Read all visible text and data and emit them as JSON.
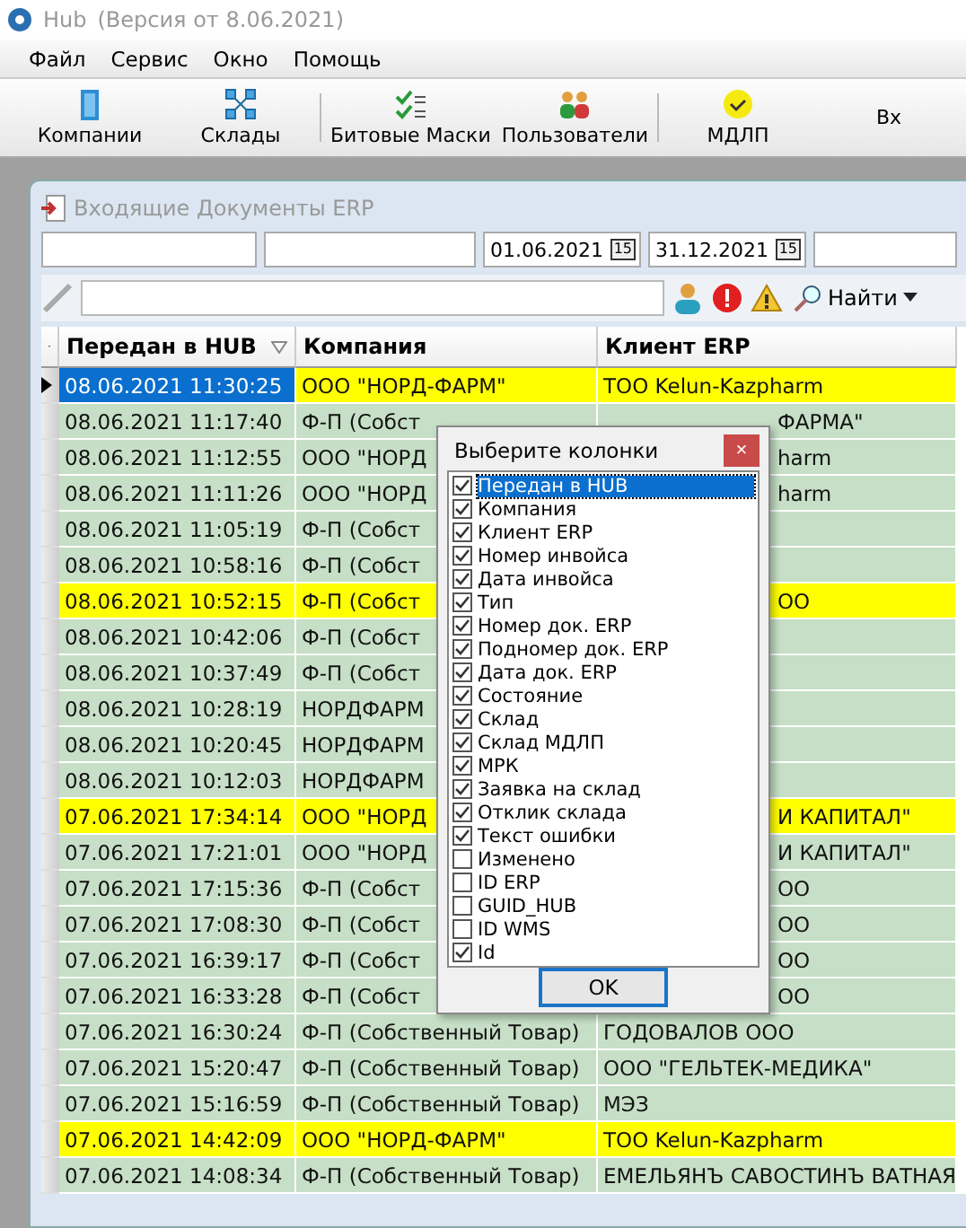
{
  "window": {
    "title": "Hub",
    "version": "(Версия от 8.06.2021)"
  },
  "menu": [
    "Файл",
    "Сервис",
    "Окно",
    "Помощь"
  ],
  "toolbar": [
    {
      "label": "Компании",
      "kind": "building"
    },
    {
      "label": "Склады",
      "kind": "network"
    },
    {
      "label": "Битовые Маски",
      "kind": "checklist",
      "separator_before": true
    },
    {
      "label": "Пользователи",
      "kind": "users"
    },
    {
      "label": "МДЛП",
      "kind": "smile",
      "separator_before": true
    },
    {
      "label": "Вх",
      "kind": "none"
    }
  ],
  "child_window": {
    "title": "Входящие Документы ERP",
    "filters": {
      "date_from": "01.06.2021",
      "date_to": "31.12.2021",
      "date_from_glyph": "15",
      "date_to_glyph": "15"
    },
    "search_button": "Найти"
  },
  "table": {
    "columns": [
      "Передан в HUB",
      "Компания",
      "Клиент ERP"
    ],
    "rows": [
      {
        "cells": [
          "08.06.2021 11:30:25",
          "ООО \"НОРД-ФАРМ\"",
          "ТОО Kelun-Kazpharm"
        ],
        "selected": true,
        "highlighted": true
      },
      {
        "cells": [
          "08.06.2021 11:17:40",
          "Ф-П (Собст",
          "ФАРМА\""
        ],
        "selected": false,
        "highlighted": false
      },
      {
        "cells": [
          "08.06.2021 11:12:55",
          "ООО \"НОРД",
          "harm"
        ],
        "selected": false,
        "highlighted": false
      },
      {
        "cells": [
          "08.06.2021 11:11:26",
          "ООО \"НОРД",
          "harm"
        ],
        "selected": false,
        "highlighted": false
      },
      {
        "cells": [
          "08.06.2021 11:05:19",
          "Ф-П (Собст",
          ""
        ],
        "selected": false,
        "highlighted": false
      },
      {
        "cells": [
          "08.06.2021 10:58:16",
          "Ф-П (Собст",
          ""
        ],
        "selected": false,
        "highlighted": false
      },
      {
        "cells": [
          "08.06.2021 10:52:15",
          "Ф-П (Собст",
          "ОО"
        ],
        "selected": false,
        "highlighted": true
      },
      {
        "cells": [
          "08.06.2021 10:42:06",
          "Ф-П (Собст",
          ""
        ],
        "selected": false,
        "highlighted": false
      },
      {
        "cells": [
          "08.06.2021 10:37:49",
          "Ф-П (Собст",
          ""
        ],
        "selected": false,
        "highlighted": false
      },
      {
        "cells": [
          "08.06.2021 10:28:19",
          "НОРДФАРМ",
          ""
        ],
        "selected": false,
        "highlighted": false
      },
      {
        "cells": [
          "08.06.2021 10:20:45",
          "НОРДФАРМ",
          ""
        ],
        "selected": false,
        "highlighted": false
      },
      {
        "cells": [
          "08.06.2021 10:12:03",
          "НОРДФАРМ",
          ""
        ],
        "selected": false,
        "highlighted": false
      },
      {
        "cells": [
          "07.06.2021 17:34:14",
          "ООО \"НОРД",
          "И КАПИТАЛ\""
        ],
        "selected": false,
        "highlighted": true
      },
      {
        "cells": [
          "07.06.2021 17:21:01",
          "ООО \"НОРД",
          "И КАПИТАЛ\""
        ],
        "selected": false,
        "highlighted": false
      },
      {
        "cells": [
          "07.06.2021 17:15:36",
          "Ф-П (Собст",
          "ОО"
        ],
        "selected": false,
        "highlighted": false
      },
      {
        "cells": [
          "07.06.2021 17:08:30",
          "Ф-П (Собст",
          "ОО"
        ],
        "selected": false,
        "highlighted": false
      },
      {
        "cells": [
          "07.06.2021 16:39:17",
          "Ф-П (Собст",
          "ОО"
        ],
        "selected": false,
        "highlighted": false
      },
      {
        "cells": [
          "07.06.2021 16:33:28",
          "Ф-П (Собст",
          "ОО"
        ],
        "selected": false,
        "highlighted": false
      },
      {
        "cells": [
          "07.06.2021 16:30:24",
          "Ф-П (Собственный Товар)",
          "ГОДОВАЛОВ ООО"
        ],
        "selected": false,
        "highlighted": false
      },
      {
        "cells": [
          "07.06.2021 15:20:47",
          "Ф-П (Собственный Товар)",
          "ООО \"ГЕЛЬТЕК-МЕДИКА\""
        ],
        "selected": false,
        "highlighted": false
      },
      {
        "cells": [
          "07.06.2021 15:16:59",
          "Ф-П (Собственный Товар)",
          "МЭЗ"
        ],
        "selected": false,
        "highlighted": false
      },
      {
        "cells": [
          "07.06.2021 14:42:09",
          "ООО \"НОРД-ФАРМ\"",
          "ТОО Kelun-Kazpharm"
        ],
        "selected": false,
        "highlighted": true
      },
      {
        "cells": [
          "07.06.2021 14:08:34",
          "Ф-П (Собственный Товар)",
          "ЕМЕЛЬЯНЪ САВОСТИНЪ ВАТНАЯ"
        ],
        "selected": false,
        "highlighted": false
      }
    ]
  },
  "dialog": {
    "title": "Выберите колонки",
    "close": "×",
    "ok": "OK",
    "items": [
      {
        "label": "Передан в HUB",
        "checked": true,
        "selected": true
      },
      {
        "label": "Компания",
        "checked": true,
        "selected": false
      },
      {
        "label": "Клиент ERP",
        "checked": true,
        "selected": false
      },
      {
        "label": "Номер инвойса",
        "checked": true,
        "selected": false
      },
      {
        "label": "Дата инвойса",
        "checked": true,
        "selected": false
      },
      {
        "label": "Тип",
        "checked": true,
        "selected": false
      },
      {
        "label": "Номер док. ERP",
        "checked": true,
        "selected": false
      },
      {
        "label": "Подномер док. ERP",
        "checked": true,
        "selected": false
      },
      {
        "label": "Дата док. ERP",
        "checked": true,
        "selected": false
      },
      {
        "label": "Состояние",
        "checked": true,
        "selected": false
      },
      {
        "label": "Склад",
        "checked": true,
        "selected": false
      },
      {
        "label": "Склад МДЛП",
        "checked": true,
        "selected": false
      },
      {
        "label": "МРК",
        "checked": true,
        "selected": false
      },
      {
        "label": "Заявка на склад",
        "checked": true,
        "selected": false
      },
      {
        "label": "Отклик склада",
        "checked": true,
        "selected": false
      },
      {
        "label": "Текст ошибки",
        "checked": true,
        "selected": false
      },
      {
        "label": "Изменено",
        "checked": false,
        "selected": false
      },
      {
        "label": "ID ERP",
        "checked": false,
        "selected": false
      },
      {
        "label": "GUID_HUB",
        "checked": false,
        "selected": false
      },
      {
        "label": "ID WMS",
        "checked": false,
        "selected": false
      },
      {
        "label": "Id",
        "checked": true,
        "selected": false
      }
    ]
  }
}
